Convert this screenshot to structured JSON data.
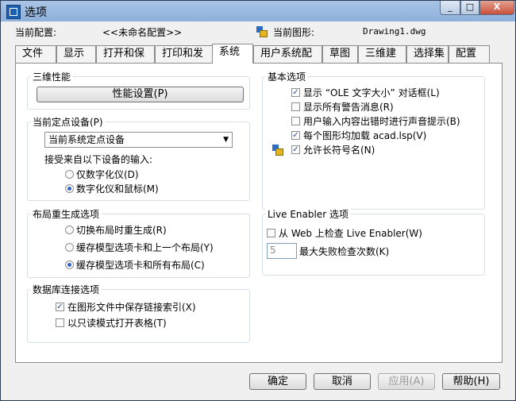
{
  "window": {
    "title": "选项",
    "minimize": "_",
    "maximize": "□",
    "close": "X"
  },
  "header": {
    "profile_label": "当前配置:",
    "profile_value": "<<未命名配置>>",
    "drawing_label": "当前图形:",
    "drawing_value": "Drawing1.dwg"
  },
  "tabs": [
    "文件",
    "显示",
    "打开和保存",
    "打印和发布",
    "系统",
    "用户系统配置",
    "草图",
    "三维建模",
    "选择集",
    "配置"
  ],
  "active_tab": "系统",
  "three_d": {
    "legend": "三维性能",
    "button": "性能设置(P)"
  },
  "pointing": {
    "legend": "当前定点设备(P)",
    "select_value": "当前系统定点设备",
    "accept_label": "接受来自以下设备的输入:",
    "options": [
      {
        "label": "仅数字化仪(D)",
        "selected": false
      },
      {
        "label": "数字化仪和鼠标(M)",
        "selected": true
      }
    ]
  },
  "layout_regen": {
    "legend": "布局重生成选项",
    "options": [
      {
        "label": "切换布局时重生成(R)",
        "selected": false
      },
      {
        "label": "缓存模型选项卡和上一个布局(Y)",
        "selected": false
      },
      {
        "label": "缓存模型选项卡和所有布局(C)",
        "selected": true
      }
    ]
  },
  "db": {
    "legend": "数据库连接选项",
    "options": [
      {
        "label": "在图形文件中保存链接索引(X)",
        "checked": true
      },
      {
        "label": "以只读模式打开表格(T)",
        "checked": false
      }
    ]
  },
  "basic": {
    "legend": "基本选项",
    "options": [
      {
        "label": "显示 “OLE 文字大小” 对话框(L)",
        "checked": true
      },
      {
        "label": "显示所有警告消息(R)",
        "checked": false
      },
      {
        "label": "用户输入内容出错时进行声音提示(B)",
        "checked": false
      },
      {
        "label": "每个图形均加载 acad.lsp(V)",
        "checked": true
      },
      {
        "label": "允许长符号名(N)",
        "checked": true
      }
    ]
  },
  "live": {
    "legend": "Live Enabler 选项",
    "check_label": "从 Web 上检查 Live Enabler(W)",
    "check_checked": false,
    "count_value": "5",
    "count_label": "最大失败检查次数(K)"
  },
  "buttons": {
    "ok": "确定",
    "cancel": "取消",
    "apply": "应用(A)",
    "help": "帮助(H)"
  },
  "glyphs": {
    "check": "✓",
    "arrow": "▼"
  }
}
